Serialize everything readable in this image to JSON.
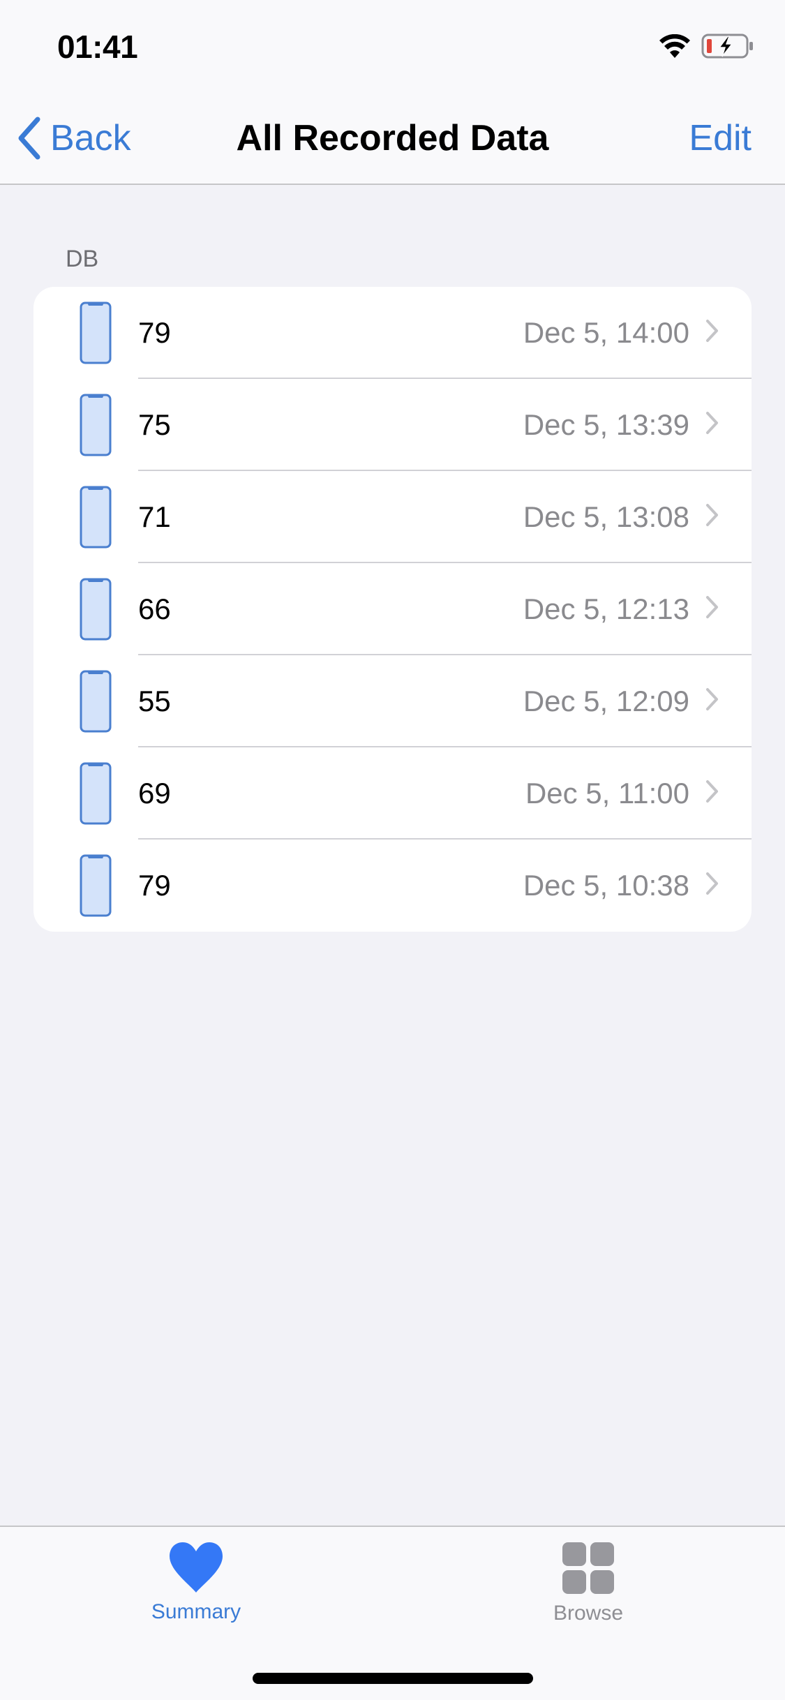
{
  "status_bar": {
    "time": "01:41",
    "icons": [
      "wifi-icon",
      "battery-charging-icon"
    ],
    "battery_level_color": "#e0463b"
  },
  "nav": {
    "back_label": "Back",
    "title": "All Recorded Data",
    "edit_label": "Edit"
  },
  "section": {
    "header": "DB"
  },
  "records": [
    {
      "value": "79",
      "date": "Dec 5, 14:00"
    },
    {
      "value": "75",
      "date": "Dec 5, 13:39"
    },
    {
      "value": "71",
      "date": "Dec 5, 13:08"
    },
    {
      "value": "66",
      "date": "Dec 5, 12:13"
    },
    {
      "value": "55",
      "date": "Dec 5, 12:09"
    },
    {
      "value": "69",
      "date": "Dec 5, 11:00"
    },
    {
      "value": "79",
      "date": "Dec 5, 10:38"
    }
  ],
  "tab_bar": {
    "tabs": [
      {
        "label": "Summary",
        "icon": "heart-icon",
        "selected": true
      },
      {
        "label": "Browse",
        "icon": "grid-icon",
        "selected": false
      }
    ]
  },
  "colors": {
    "accent": "#3a7bd5",
    "secondary_text": "#8a8a8e",
    "background": "#f2f2f7"
  }
}
